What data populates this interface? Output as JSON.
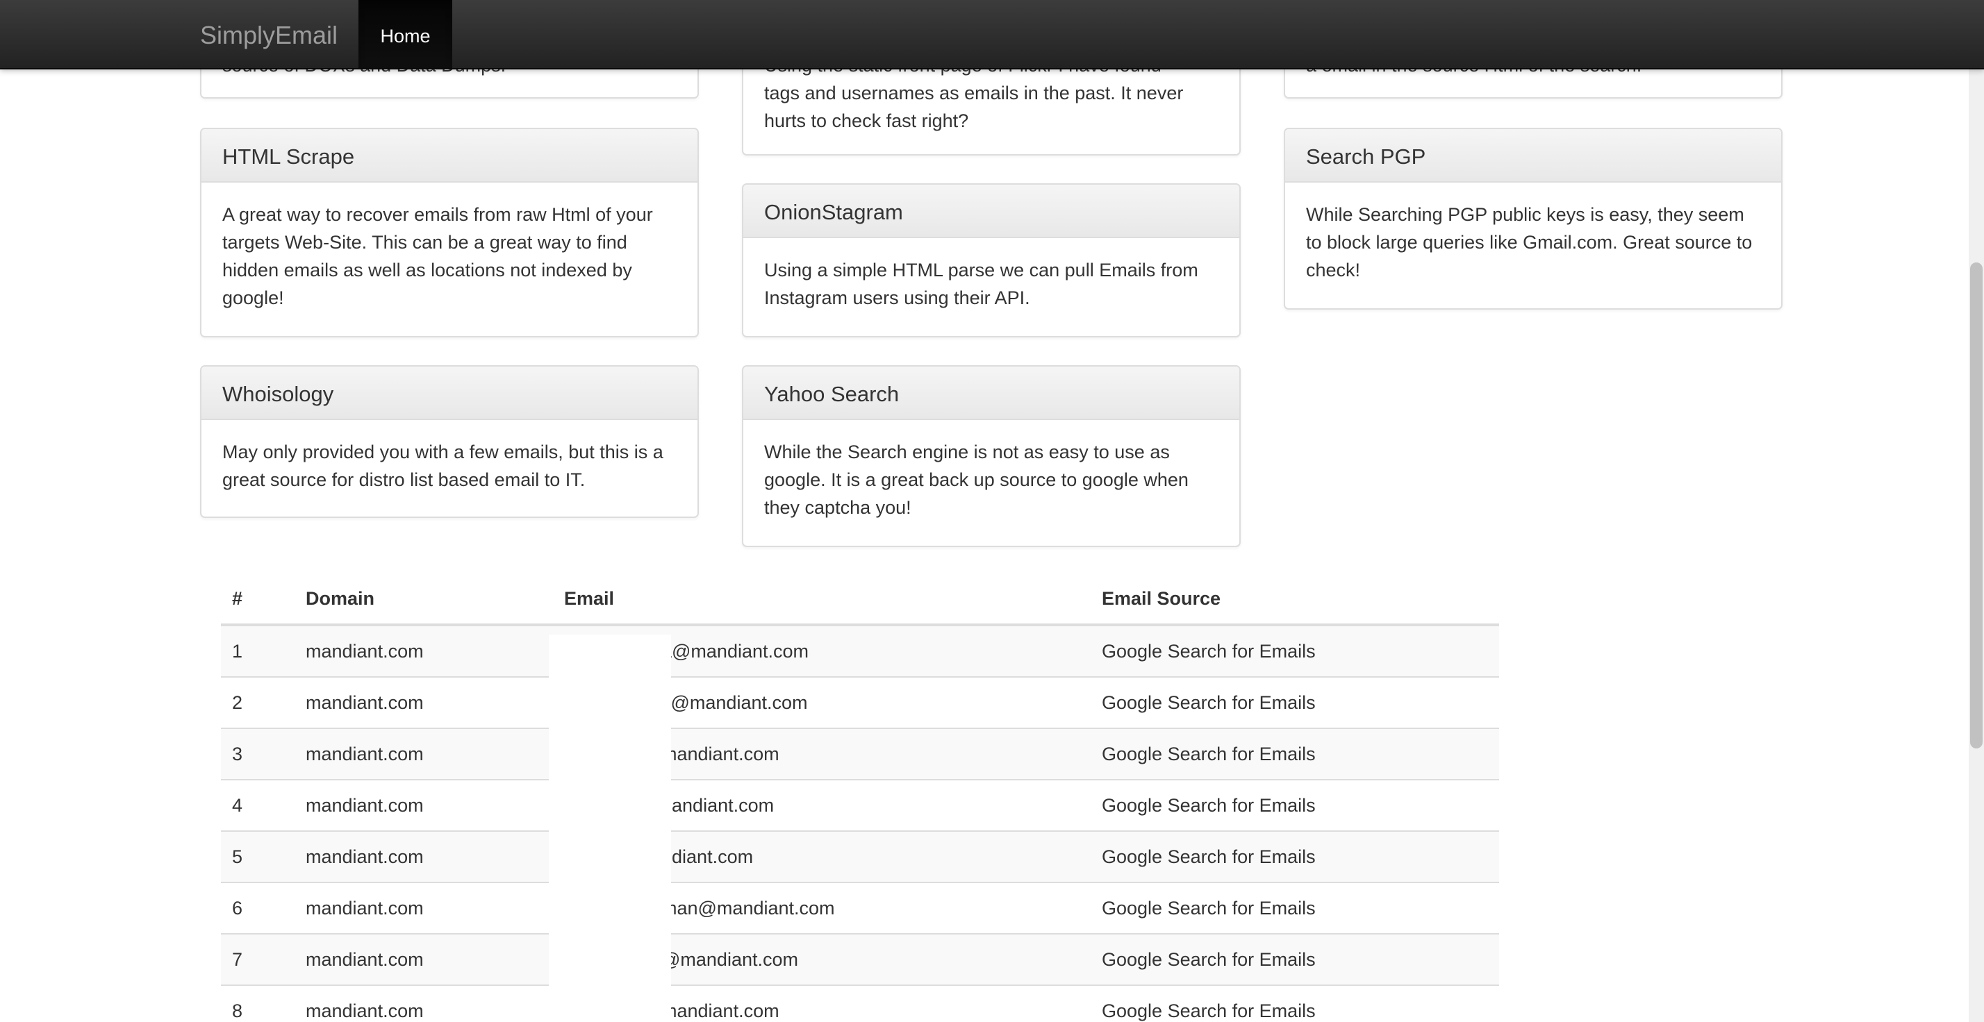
{
  "navbar": {
    "brand": "SimplyEmail",
    "home": "Home"
  },
  "panels": {
    "top_left_partial": "source of DOXs and Data Dumps.",
    "top_mid_partial_1": "Using the static front page of Flickr I have found",
    "top_mid_partial_2": "tags and usernames as emails in the past. It never",
    "top_mid_partial_3": "hurts to check fast right?",
    "top_right_partial": "a email in the source Html of the search.",
    "html_scrape": {
      "title": "HTML Scrape",
      "body": "A great way to recover emails from raw Html of your targets Web-Site. This can be a great way to find hidden emails as well as locations not indexed by google!"
    },
    "onionstagram": {
      "title": "OnionStagram",
      "body": "Using a simple HTML parse we can pull Emails from Instagram users using their API."
    },
    "search_pgp": {
      "title": "Search PGP",
      "body": "While Searching PGP public keys is easy, they seem to block large queries like Gmail.com. Great source to check!"
    },
    "whoisology": {
      "title": "Whoisology",
      "body": "May only provided you with a few emails, but this is a great source for distro list based email to IT."
    },
    "yahoo_search": {
      "title": "Yahoo Search",
      "body": "While the Search engine is not as easy to use as google. It is a great back up source to google when they captcha you!"
    }
  },
  "table": {
    "headers": {
      "num": "#",
      "domain": "Domain",
      "email": "Email",
      "source": "Email Source"
    },
    "rows": [
      {
        "num": "1",
        "domain": "mandiant.com",
        "email": "a@mandiant.com",
        "source": "Google Search for Emails"
      },
      {
        "num": "2",
        "domain": "mandiant.com",
        "email": "s@mandiant.com",
        "source": "Google Search for Emails"
      },
      {
        "num": "3",
        "domain": "mandiant.com",
        "email": "mandiant.com",
        "source": "Google Search for Emails"
      },
      {
        "num": "4",
        "domain": "mandiant.com",
        "email": "nandiant.com",
        "source": "Google Search for Emails"
      },
      {
        "num": "5",
        "domain": "mandiant.com",
        "email": "ndiant.com",
        "source": "Google Search for Emails"
      },
      {
        "num": "6",
        "domain": "mandiant.com",
        "email": "man@mandiant.com",
        "source": "Google Search for Emails"
      },
      {
        "num": "7",
        "domain": "mandiant.com",
        "email": "@mandiant.com",
        "source": "Google Search for Emails"
      },
      {
        "num": "8",
        "domain": "mandiant.com",
        "email": "mandiant.com",
        "source": "Google Search for Emails"
      }
    ]
  }
}
